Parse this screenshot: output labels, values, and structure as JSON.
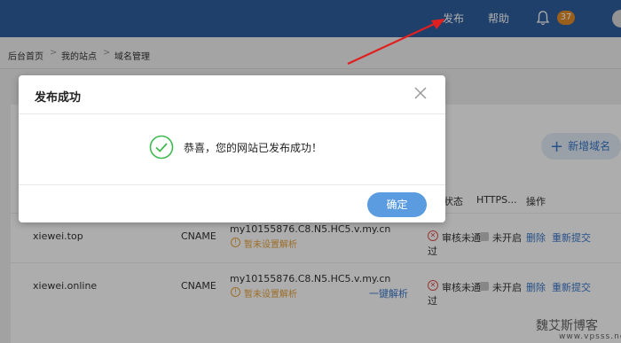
{
  "topbar": {
    "publish_label": "发布",
    "help_label": "帮助",
    "notification_count": "37",
    "bell_icon": "bell-icon",
    "background_color": "#2f5f9e"
  },
  "breadcrumb": {
    "items": [
      "后台首页",
      "我的站点",
      "域名管理"
    ],
    "separator": ">"
  },
  "page": {
    "add_domain_label": "新增域名",
    "table_headers": [
      "解析状态",
      "HTTPS...",
      "操作"
    ],
    "rows": [
      {
        "domain": "xiewei.top",
        "type": "CNAME",
        "value": "my10155876.C8.N5.HC5.v.my.cn",
        "warning": "暂未设置解析",
        "status_prefix": "审核未通",
        "status_suffix": "过",
        "https": "未开启",
        "action_delete": "删除",
        "action_resubmit": "重新提交"
      },
      {
        "domain": "xiewei.online",
        "type": "CNAME",
        "value": "my10155876.C8.N5.HC5.v.my.cn",
        "warning": "暂未设置解析",
        "quick_resolve": "一键解析",
        "status_prefix": "审核未通",
        "status_suffix": "过",
        "https": "未开启",
        "action_delete": "删除",
        "action_resubmit": "重新提交"
      }
    ]
  },
  "modal": {
    "title": "发布成功",
    "message": "恭喜，您的网站已发布成功！",
    "confirm_label": "确定",
    "success_color": "#3fb950",
    "confirm_color": "#5b9be0"
  },
  "watermark": {
    "text": "魏艾斯博客",
    "url": "www.vpsss.net"
  },
  "annotation_color": "#e02020"
}
